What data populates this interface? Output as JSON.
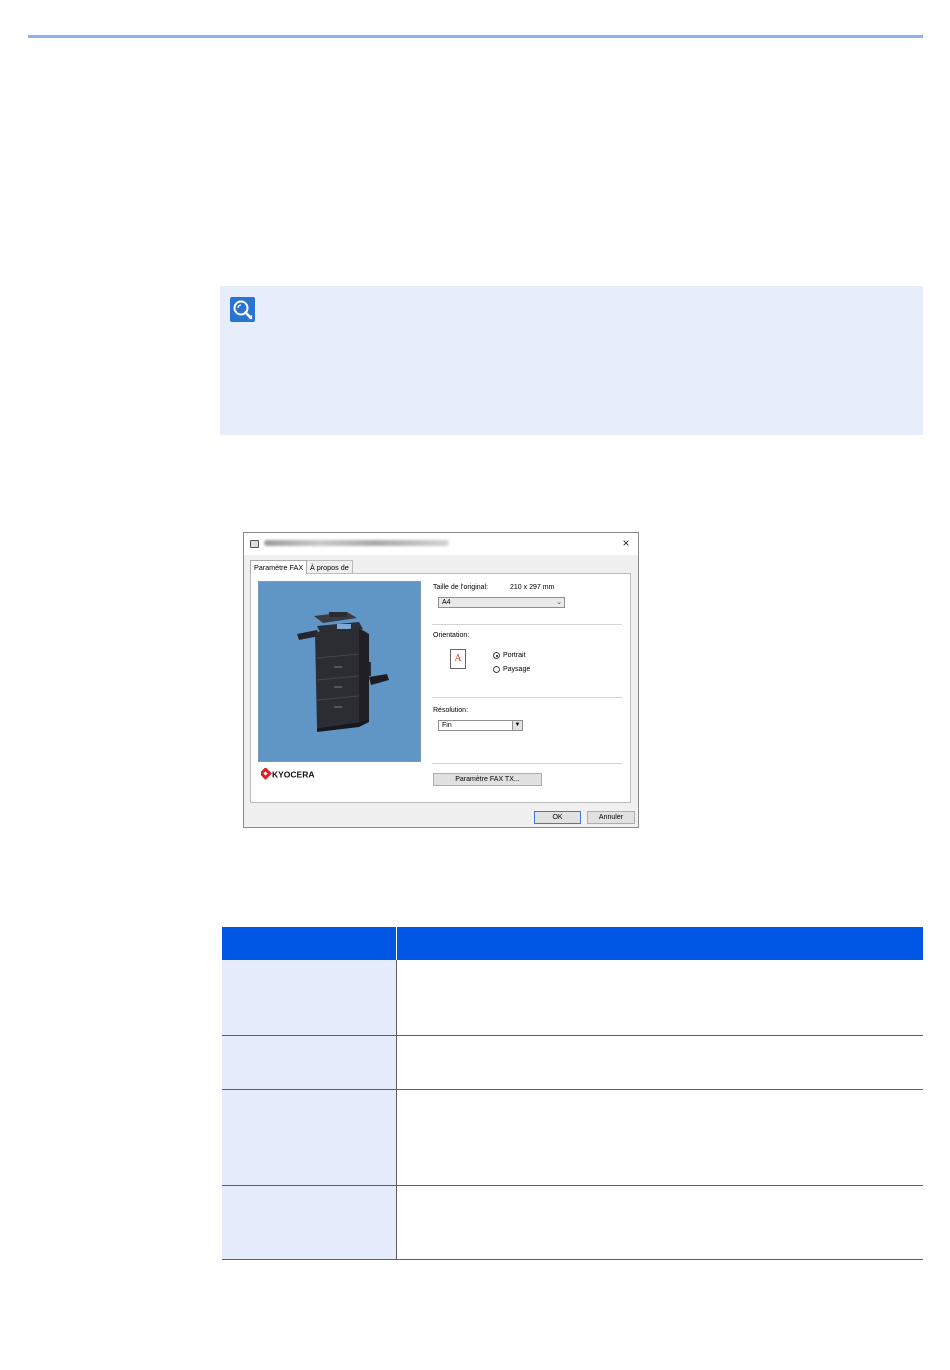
{
  "page": {
    "accent_color": "#8db1ea",
    "note_bg_color": "#e7eefb",
    "table_header_color": "#0057e3",
    "table_key_bg_color": "#e6ecfb"
  },
  "note": {
    "icon": "lightbulb-icon"
  },
  "dialog": {
    "printer_icon": "printer-icon",
    "close_label": "×",
    "tabs": [
      {
        "label": "Paramètre FAX"
      },
      {
        "label": "À propos de"
      }
    ],
    "preview_image": "printer-preview-image",
    "brand_logo": "KYOCERA",
    "original_size": {
      "label": "Taille de l'original:",
      "dimension": "210 x 297 mm",
      "value": "A4"
    },
    "orientation": {
      "label": "Orientation:",
      "icon_letter": "A",
      "options": [
        {
          "label": "Portrait",
          "selected": true
        },
        {
          "label": "Paysage",
          "selected": false
        }
      ]
    },
    "resolution": {
      "label": "Résolution:",
      "value": "Fin"
    },
    "fax_tx_button": "Paramètre FAX TX...",
    "ok_button": "OK",
    "cancel_button": "Annuler"
  },
  "table": {
    "header": [
      "",
      ""
    ],
    "rows": [
      [
        "",
        ""
      ],
      [
        "",
        ""
      ],
      [
        "",
        ""
      ],
      [
        "",
        ""
      ]
    ]
  }
}
